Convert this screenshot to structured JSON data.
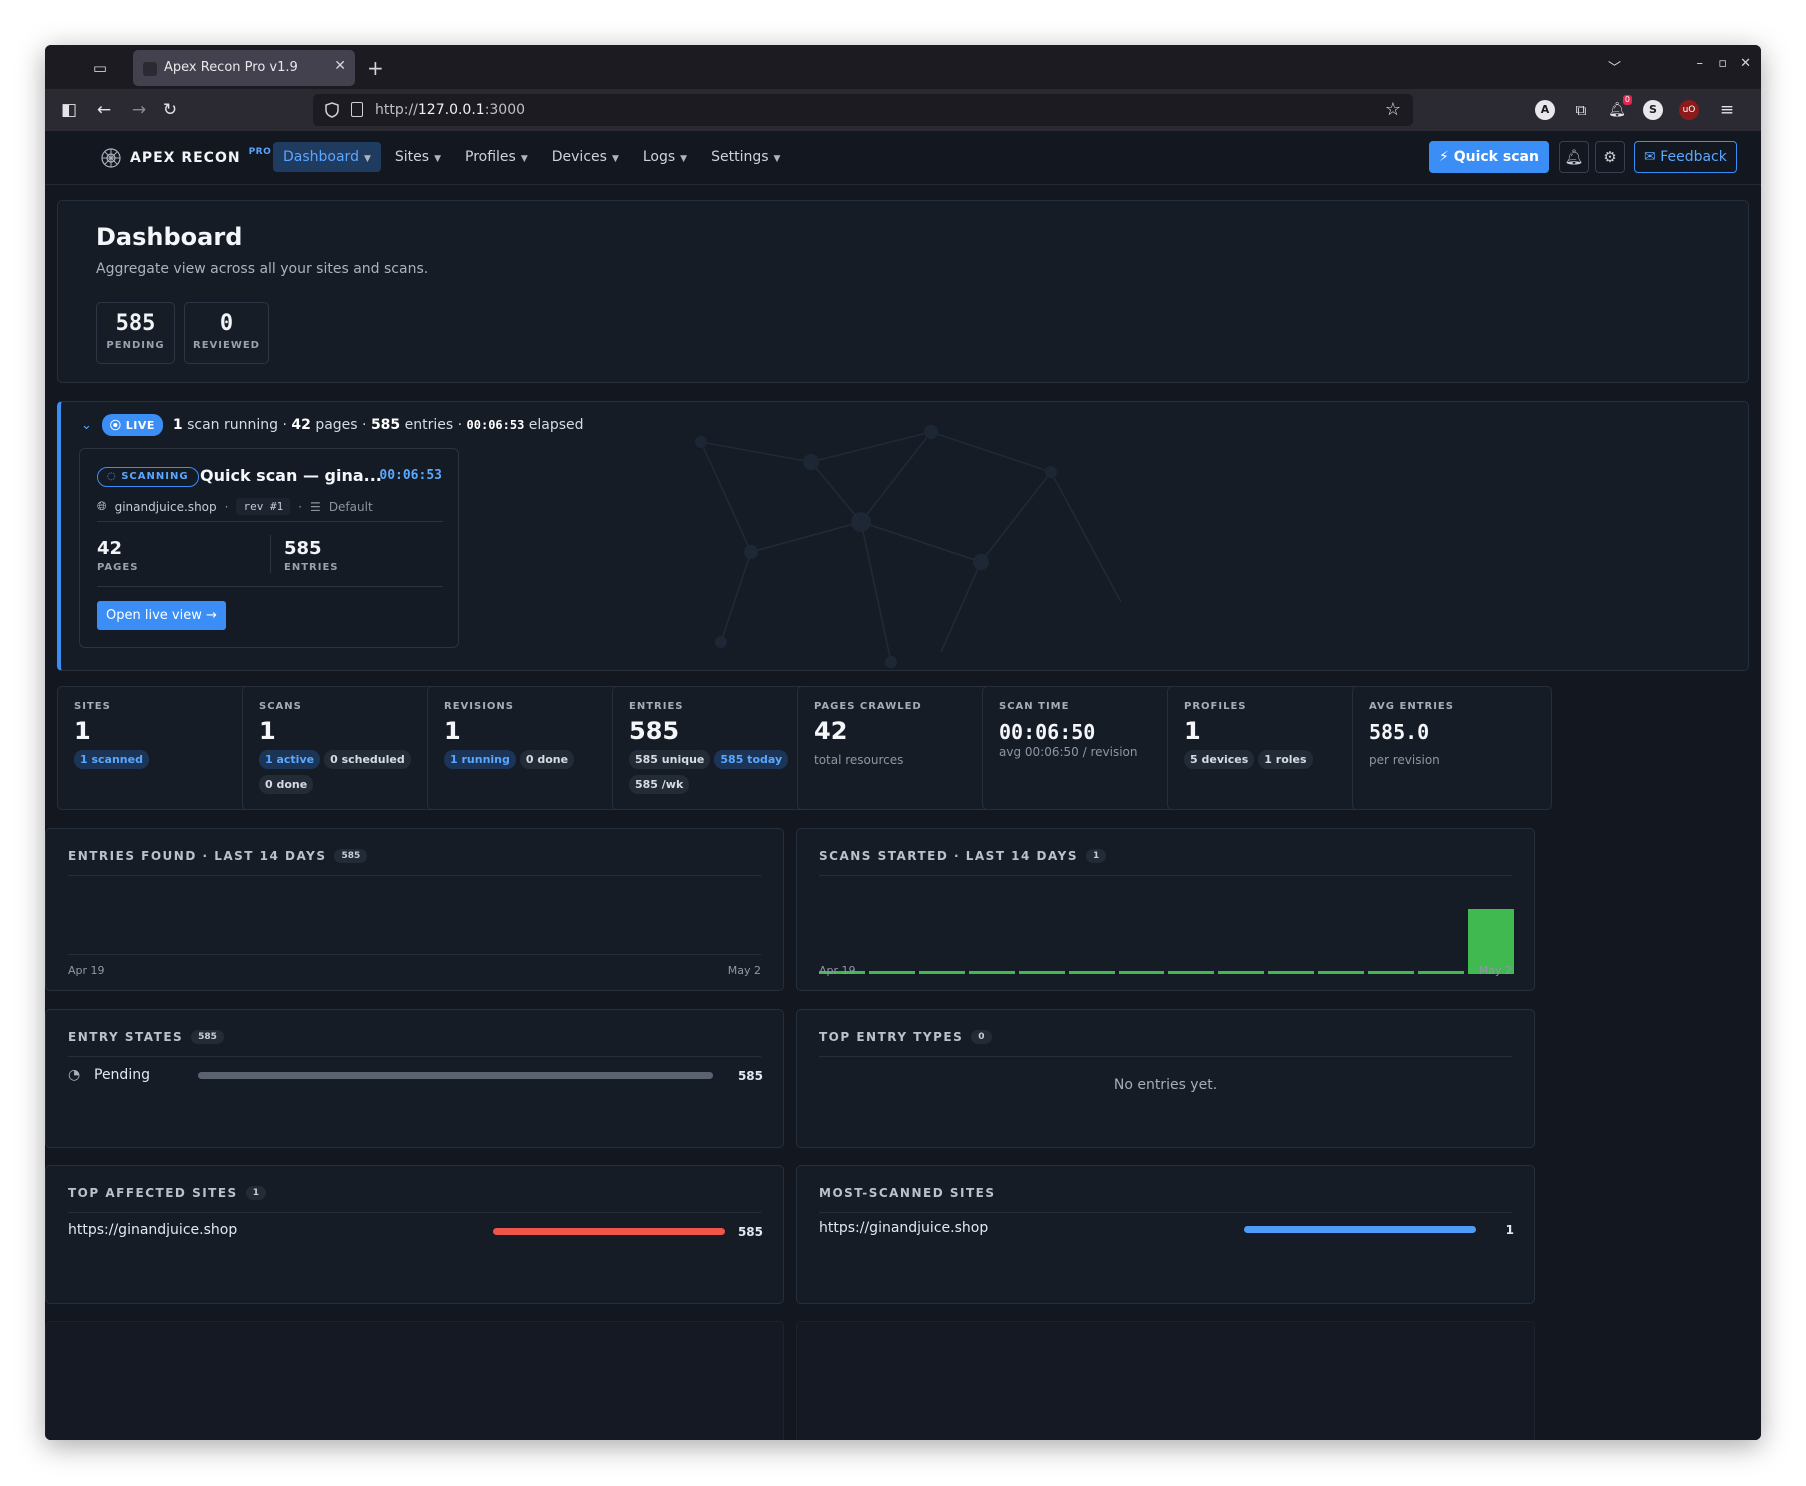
{
  "browser": {
    "tab_title": "Apex Recon Pro v1.9",
    "url_prefix": "http://",
    "url_host": "127.0.0.1",
    "url_suffix": ":3000",
    "ext_badge_count": "0"
  },
  "nav": {
    "brand": "APEX RECON",
    "brand_tag": "PRO",
    "menu": [
      "Dashboard",
      "Sites",
      "Profiles",
      "Devices",
      "Logs",
      "Settings"
    ],
    "active_menu": "Dashboard",
    "quick_scan": "Quick scan",
    "feedback": "Feedback"
  },
  "header": {
    "title": "Dashboard",
    "subtitle": "Aggregate view across all your sites and scans.",
    "pending": {
      "value": "585",
      "label": "PENDING"
    },
    "reviewed": {
      "value": "0",
      "label": "REVIEWED"
    }
  },
  "live": {
    "pill": "LIVE",
    "scans_running": "1",
    "scans_running_text": "scan running ·",
    "pages": "42",
    "pages_text": "pages ·",
    "entries": "585",
    "entries_text": "entries ·",
    "elapsed": "00:06:53",
    "elapsed_text": "elapsed",
    "scan": {
      "status": "SCANNING",
      "title": "Quick scan — gina...",
      "timer": "00:06:53",
      "site": "ginandjuice.shop",
      "revision": "rev #1",
      "profile": "Default",
      "pages": {
        "value": "42",
        "label": "PAGES"
      },
      "entries": {
        "value": "585",
        "label": "ENTRIES"
      },
      "open_button": "Open live view"
    }
  },
  "stats": [
    {
      "label": "SITES",
      "value": "1",
      "chips": [
        {
          "text": "1 scanned",
          "style": "blue"
        }
      ]
    },
    {
      "label": "SCANS",
      "value": "1",
      "chips": [
        {
          "text": "1 active",
          "style": "blue"
        },
        {
          "text": "0 scheduled",
          "style": "gray"
        },
        {
          "text": "0 done",
          "style": "gray"
        }
      ]
    },
    {
      "label": "REVISIONS",
      "value": "1",
      "chips": [
        {
          "text": "1 running",
          "style": "blue"
        },
        {
          "text": "0 done",
          "style": "gray"
        }
      ]
    },
    {
      "label": "ENTRIES",
      "value": "585",
      "chips": [
        {
          "text": "585 unique",
          "style": "gray"
        },
        {
          "text": "585 today",
          "style": "blue"
        },
        {
          "text": "585 /wk",
          "style": "gray"
        }
      ]
    },
    {
      "label": "PAGES CRAWLED",
      "value": "42",
      "caption": "total resources"
    },
    {
      "label": "SCAN TIME",
      "value": "00:06:50",
      "caption": "avg 00:06:50 / revision"
    },
    {
      "label": "PROFILES",
      "value": "1",
      "chips": [
        {
          "text": "5 devices",
          "style": "gray"
        },
        {
          "text": "1 roles",
          "style": "gray"
        }
      ]
    },
    {
      "label": "AVG ENTRIES",
      "value": "585.0",
      "caption": "per revision"
    }
  ],
  "entries_chart": {
    "title": "ENTRIES FOUND · LAST 14 DAYS",
    "count": "585",
    "x_start": "Apr 19",
    "x_end": "May 2"
  },
  "chart_data": {
    "type": "bar",
    "title": "SCANS STARTED · LAST 14 DAYS",
    "count": "1",
    "x_start": "Apr 19",
    "x_end": "May 2",
    "values": [
      0,
      0,
      0,
      0,
      0,
      0,
      0,
      0,
      0,
      0,
      0,
      0,
      0,
      1
    ],
    "color": "#3fb950"
  },
  "entry_states": {
    "title": "ENTRY STATES",
    "count": "585",
    "rows": [
      {
        "label": "Pending",
        "value": "585",
        "fraction": 1.0,
        "color": "#5b6270"
      }
    ]
  },
  "top_entry_types": {
    "title": "TOP ENTRY TYPES",
    "count": "0",
    "empty": "No entries yet."
  },
  "top_affected": {
    "title": "TOP AFFECTED SITES",
    "count": "1",
    "rows": [
      {
        "label": "https://ginandjuice.shop",
        "value": "585",
        "fraction": 1.0,
        "color": "#f0554a"
      }
    ]
  },
  "most_scanned": {
    "title": "MOST-SCANNED SITES",
    "rows": [
      {
        "label": "https://ginandjuice.shop",
        "value": "1",
        "fraction": 1.0,
        "color": "#4f9cf7"
      }
    ]
  },
  "colors": {
    "accent": "#3a8ef6",
    "bg": "#121720",
    "card": "#161c26",
    "success": "#3fb950",
    "danger": "#f0554a"
  }
}
